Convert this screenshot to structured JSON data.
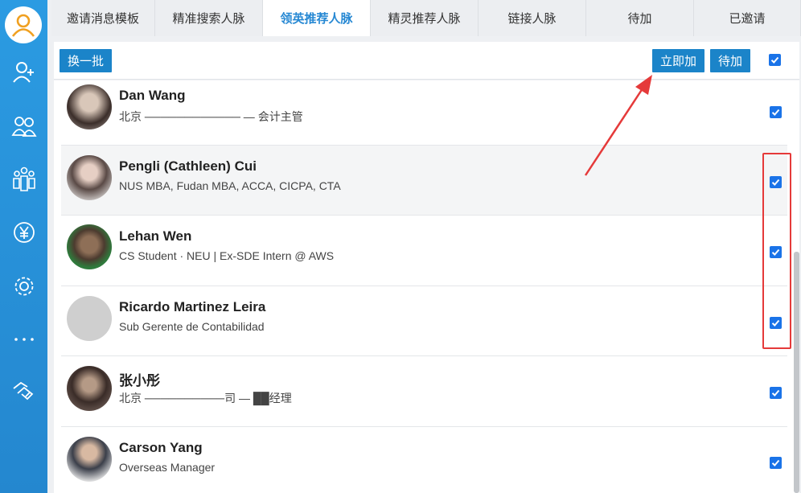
{
  "sidebar": {
    "icons": [
      "avatar-icon",
      "add-user-icon",
      "contacts-icon",
      "group-icon",
      "yuan-icon",
      "settings-icon",
      "more-icon",
      "handshake-icon"
    ]
  },
  "tabs": [
    {
      "label": "邀请消息模板",
      "active": false
    },
    {
      "label": "精准搜索人脉",
      "active": false
    },
    {
      "label": "领英推荐人脉",
      "active": true
    },
    {
      "label": "精灵推荐人脉",
      "active": false
    },
    {
      "label": "链接人脉",
      "active": false
    },
    {
      "label": "待加",
      "active": false
    },
    {
      "label": "已邀请",
      "active": false
    }
  ],
  "toolbar": {
    "refresh_label": "换一批",
    "add_now_label": "立即加",
    "pending_label": "待加",
    "select_all_checked": true
  },
  "contacts": [
    {
      "name": "Dan Wang",
      "subtitle": "北京 ──────────── — 会计主管",
      "checked": true,
      "highlighted": false
    },
    {
      "name": "Pengli (Cathleen) Cui",
      "subtitle": "NUS MBA, Fudan MBA, ACCA, CICPA, CTA",
      "checked": true,
      "highlighted": true
    },
    {
      "name": "Lehan Wen",
      "subtitle": "CS Student · NEU | Ex-SDE Intern @ AWS",
      "checked": true,
      "highlighted": false
    },
    {
      "name": "Ricardo Martinez Leira",
      "subtitle": "Sub Gerente de Contabilidad",
      "checked": true,
      "highlighted": false
    },
    {
      "name": "张小彤",
      "subtitle": "北京 ──────────司 — ██经理",
      "checked": true,
      "highlighted": false
    },
    {
      "name": "Carson Yang",
      "subtitle": "Overseas Manager",
      "checked": true,
      "highlighted": false
    }
  ],
  "colors": {
    "accent": "#1b84c9",
    "sidebar": "#2b9be2",
    "annotation": "#e53a3a"
  }
}
